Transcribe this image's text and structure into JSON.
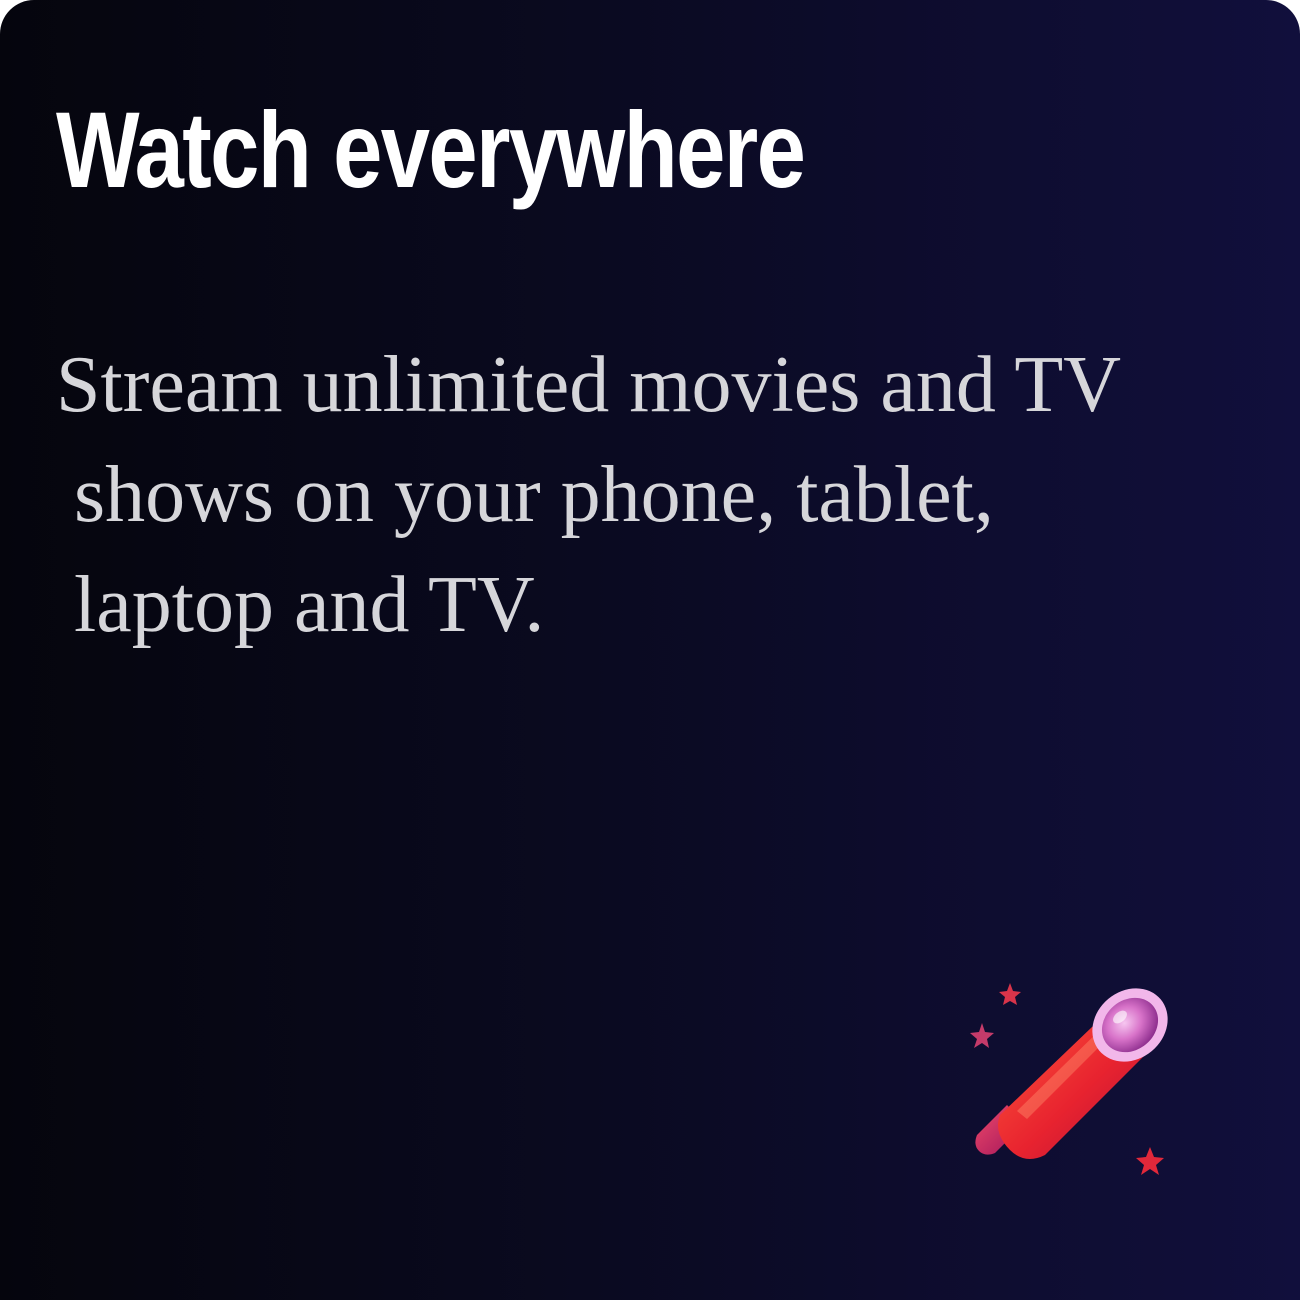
{
  "card": {
    "title": "Watch everywhere",
    "description_lines": [
      "Stream unlimited movies and TV",
      "shows on your phone, tablet,",
      "laptop and TV."
    ],
    "icon": "telescope-icon"
  },
  "colors": {
    "background_start": "#05050d",
    "background_end": "#110f3c",
    "title": "#ffffff",
    "description": "#d6d6da",
    "telescope_red": "#e8232f",
    "telescope_lens": "#e88fd8"
  }
}
